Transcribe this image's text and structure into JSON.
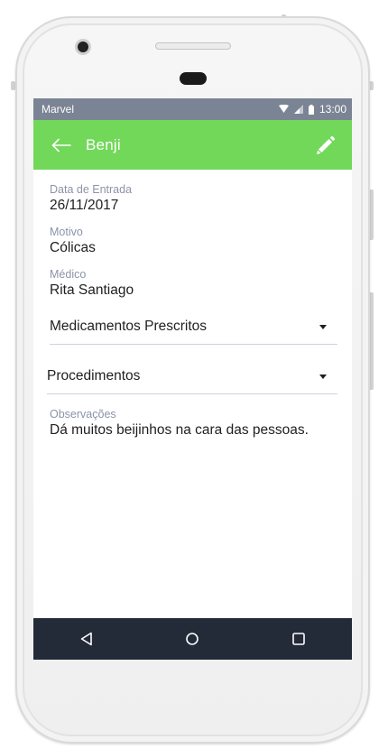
{
  "status_bar": {
    "carrier": "Marvel",
    "time": "13:00",
    "icons": [
      "wifi-icon",
      "signal-icon",
      "battery-icon"
    ]
  },
  "app_bar": {
    "title": "Benji",
    "back_icon": "arrow-left-icon",
    "edit_icon": "pencil-icon"
  },
  "details": {
    "data_entrada": {
      "label": "Data de Entrada",
      "value": "26/11/2017"
    },
    "motivo": {
      "label": "Motivo",
      "value": "Cólicas"
    },
    "medico": {
      "label": "Médico",
      "value": "Rita Santiago"
    }
  },
  "dropdowns": {
    "medicamentos": {
      "label": "Medicamentos Prescritos"
    },
    "procedimentos": {
      "label": "Procedimentos"
    }
  },
  "observacoes": {
    "label": "Observações",
    "value": "Dá muitos beijinhos na cara das pessoas."
  },
  "nav_bar": {
    "icons": [
      "back-triangle-icon",
      "home-circle-icon",
      "recents-square-icon"
    ]
  },
  "colors": {
    "accent": "#72d85a",
    "status_bar": "#7b8494",
    "nav_bar": "#232a38",
    "label": "#8b94a8"
  }
}
